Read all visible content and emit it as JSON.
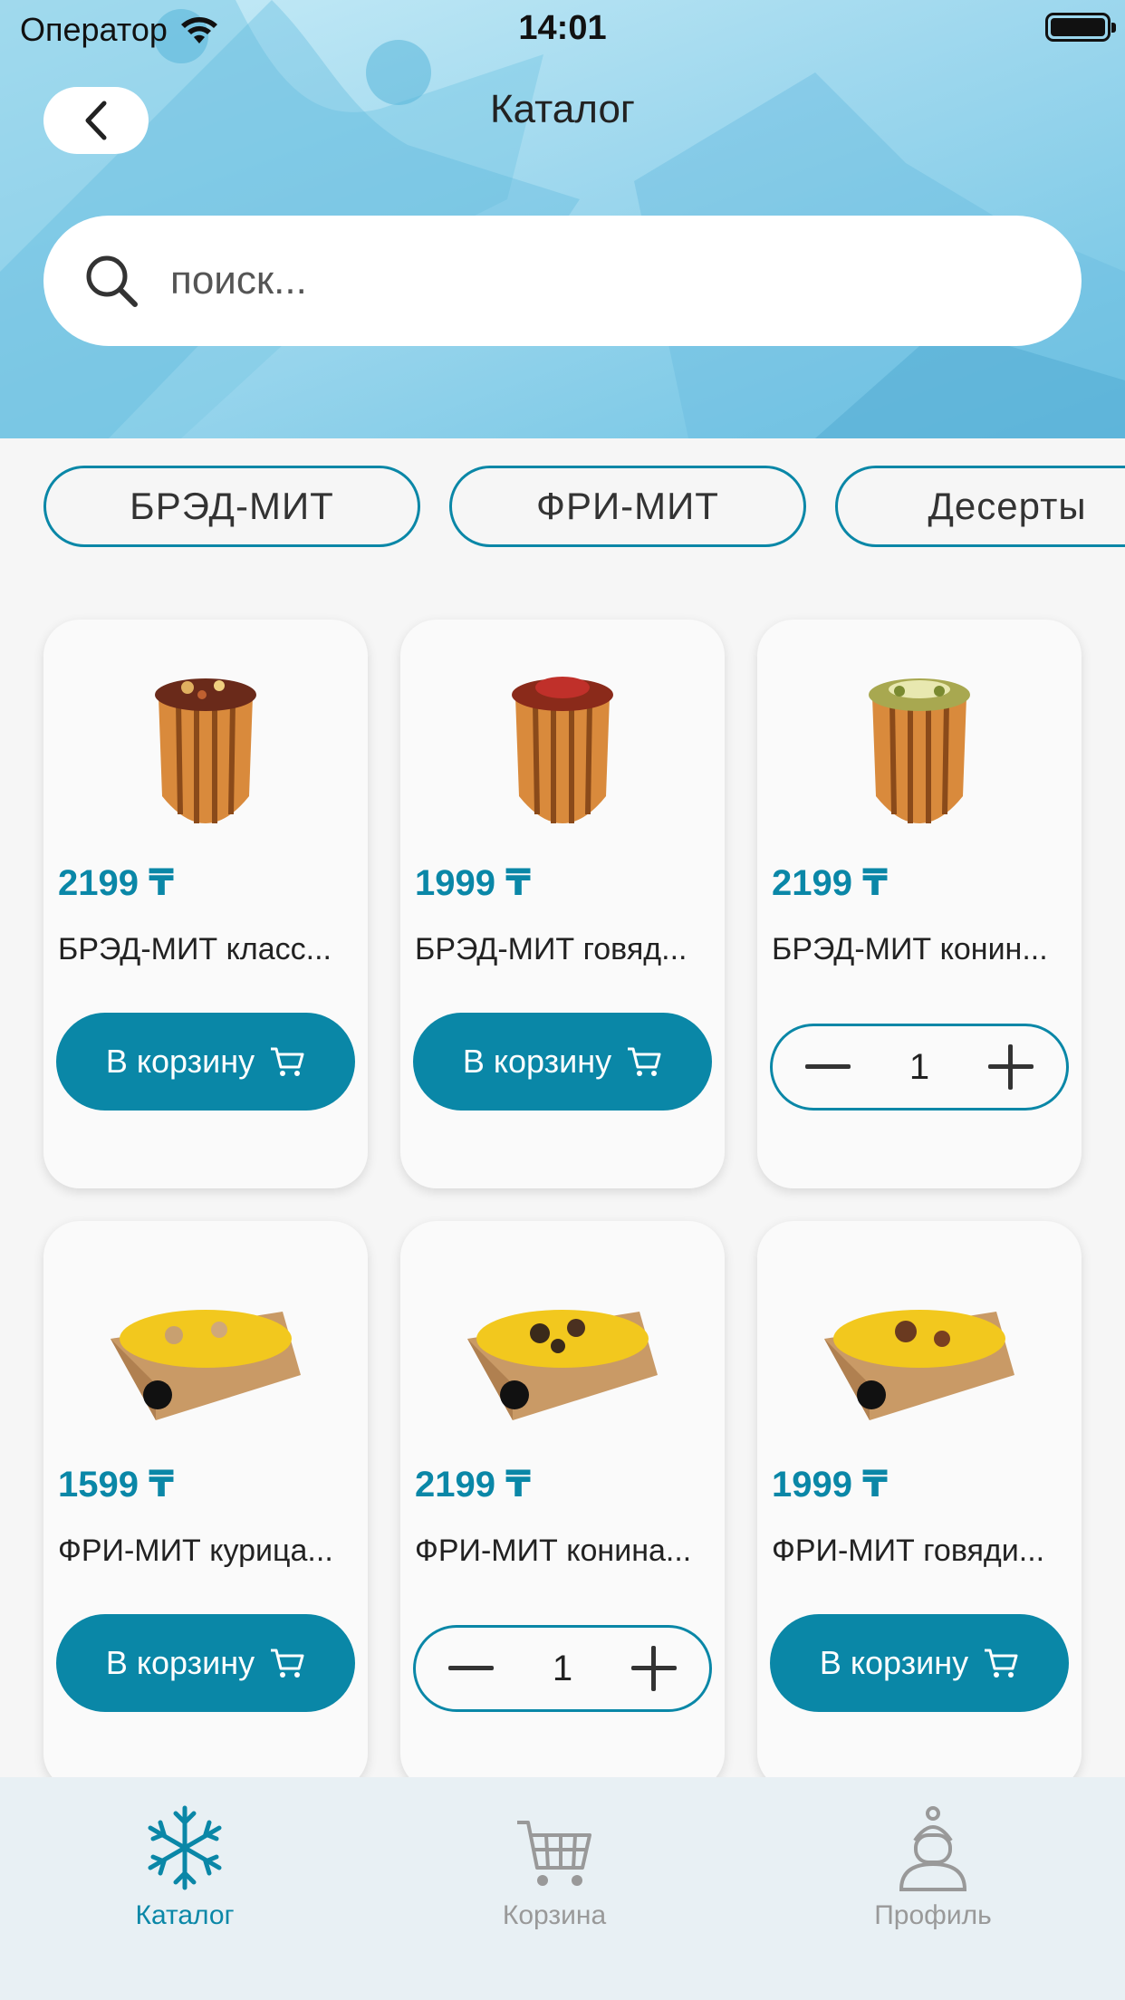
{
  "status": {
    "carrier": "Оператор",
    "time": "14:01"
  },
  "header": {
    "title": "Каталог"
  },
  "search": {
    "placeholder": "поиск..."
  },
  "categories": [
    "БРЭД-МИТ",
    "ФРИ-МИТ",
    "Десерты"
  ],
  "products": [
    {
      "price": "2199 ₸",
      "name": "БРЭД-МИТ класс...",
      "action": "cart",
      "button": "В корзину"
    },
    {
      "price": "1999 ₸",
      "name": "БРЭД-МИТ говяд...",
      "action": "cart",
      "button": "В корзину"
    },
    {
      "price": "2199 ₸",
      "name": "БРЭД-МИТ конин...",
      "action": "stepper",
      "qty": "1"
    },
    {
      "price": "1599 ₸",
      "name": "ФРИ-МИТ курица...",
      "action": "cart",
      "button": "В корзину"
    },
    {
      "price": "2199 ₸",
      "name": "ФРИ-МИТ конина...",
      "action": "stepper",
      "qty": "1"
    },
    {
      "price": "1999 ₸",
      "name": "ФРИ-МИТ говяди...",
      "action": "cart",
      "button": "В корзину"
    }
  ],
  "tabs": [
    {
      "label": "Каталог",
      "icon": "snowflake-icon",
      "active": true
    },
    {
      "label": "Корзина",
      "icon": "cart-icon",
      "active": false
    },
    {
      "label": "Профиль",
      "icon": "profile-icon",
      "active": false
    }
  ],
  "colors": {
    "accent": "#0a87a7",
    "header_bg": "#9fd8ee",
    "tabbar_bg": "#e8f0f4"
  }
}
